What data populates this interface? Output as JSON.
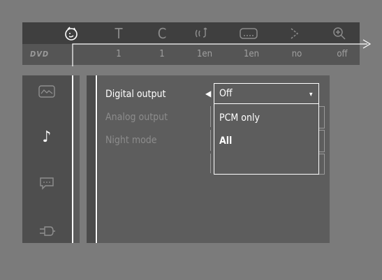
{
  "top_bar": {
    "icons": [
      {
        "name": "settings-face-icon",
        "glyph": "ⓒ",
        "active": true
      },
      {
        "name": "title-icon",
        "glyph": "T",
        "active": false
      },
      {
        "name": "chapter-icon",
        "glyph": "C",
        "active": false
      },
      {
        "name": "audio-language-icon",
        "glyph": "((",
        "active": false
      },
      {
        "name": "subtitle-icon",
        "glyph": "▭",
        "active": false
      },
      {
        "name": "angle-icon",
        "glyph": "⋗",
        "active": false
      },
      {
        "name": "zoom-icon",
        "glyph": "⊕",
        "active": false
      }
    ],
    "values": [
      "1",
      "1",
      "1en",
      "1en",
      "no",
      "off"
    ],
    "logo": "DVD"
  },
  "side_menu": {
    "icons": [
      {
        "name": "picture-icon",
        "glyph": "⌘",
        "active": false
      },
      {
        "name": "music-note-icon",
        "glyph": "♪",
        "active": true
      },
      {
        "name": "speech-bubble-icon",
        "glyph": "…",
        "active": false
      },
      {
        "name": "plug-icon",
        "glyph": "⊏",
        "active": false
      }
    ]
  },
  "settings": {
    "items": [
      {
        "label": "Digital output",
        "active": true
      },
      {
        "label": "Analog output",
        "active": false
      },
      {
        "label": "Night mode",
        "active": false
      }
    ],
    "selector_arrow": "◀"
  },
  "dropdown": {
    "selected": "Off",
    "options": [
      "PCM only",
      "All"
    ],
    "caret": "▾"
  }
}
